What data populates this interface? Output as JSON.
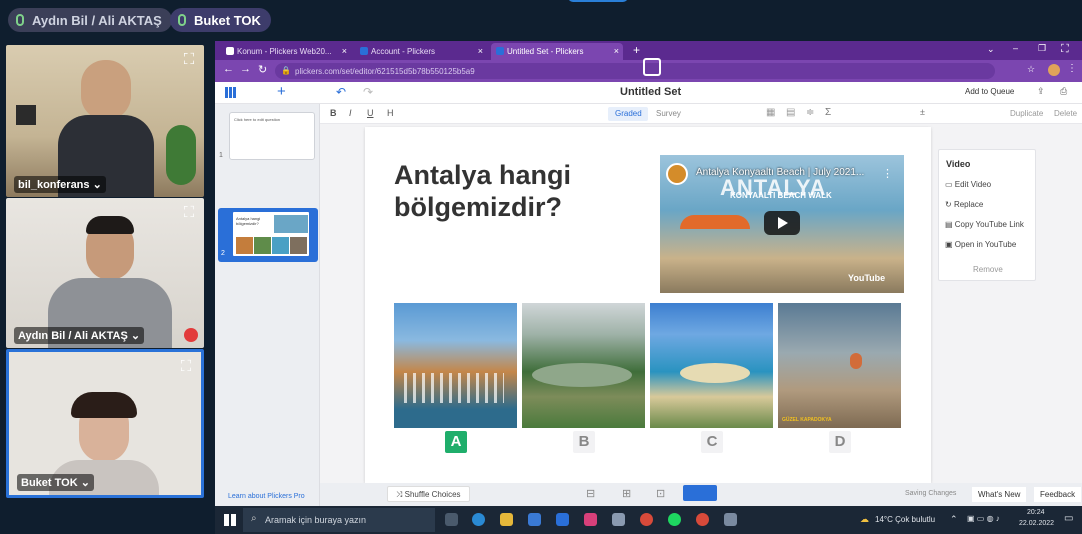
{
  "meeting": {
    "speakers": [
      {
        "label": "Aydın Bil / Ali AKTAŞ"
      },
      {
        "label": "Buket TOK"
      }
    ],
    "participants": [
      {
        "name": "bil_konferans ⌄"
      },
      {
        "name": "Aydın Bil / Ali AKTAŞ ⌄"
      },
      {
        "name": "Buket TOK ⌄"
      }
    ]
  },
  "browser": {
    "tabs": [
      {
        "label": "Konum - Plickers Web20..."
      },
      {
        "label": "Account - Plickers"
      },
      {
        "label": "Untitled Set - Plickers"
      }
    ],
    "new_tab": "+",
    "url": "plickers.com/set/editor/621515d5b78b550125b5a9"
  },
  "app": {
    "title": "Untitled Set",
    "add_to_queue": "Add to Queue",
    "format": {
      "bold": "B",
      "italic": "I",
      "underline": "U",
      "heading": "H"
    },
    "modes": {
      "graded": "Graded",
      "survey": "Survey"
    },
    "duplicate": "Duplicate",
    "delete": "Delete",
    "slides": [
      {
        "num": "1",
        "text": "Click here to edit question"
      },
      {
        "num": "2",
        "text": "Antalya hangi bölgemizdir?"
      }
    ],
    "question": "Antalya hangi\nbölgemizdir?",
    "video": {
      "title": "Antalya Konyaaltı Beach | July 2021...",
      "overlay_big": "ANTALYA",
      "overlay_small": "KONYAALTI BEACH WALK",
      "brand": "YouTube"
    },
    "choices": [
      {
        "letter": "A",
        "correct": true
      },
      {
        "letter": "B",
        "correct": false
      },
      {
        "letter": "C",
        "correct": false
      },
      {
        "letter": "D",
        "correct": false
      }
    ],
    "choice_d_caption": "GÜZEL KAPADOKYA",
    "video_panel": {
      "title": "Video",
      "items": [
        "Edit Video",
        "Replace",
        "Copy YouTube Link",
        "Open in YouTube"
      ],
      "remove": "Remove"
    },
    "footer": {
      "learn": "Learn about Plickers Pro",
      "shuffle": "Shuffle Choices",
      "saving": "Saving Changes",
      "whats_new": "What's New",
      "feedback": "Feedback"
    }
  },
  "taskbar": {
    "search_placeholder": "Aramak için buraya yazın",
    "weather": "14°C  Çok bulutlu",
    "time": "20:24",
    "date": "22.02.2022"
  },
  "colors": {
    "browser_frame": "#5b2a8f",
    "correct_green": "#1fae6b",
    "selected_blue": "#2a6fd8"
  }
}
